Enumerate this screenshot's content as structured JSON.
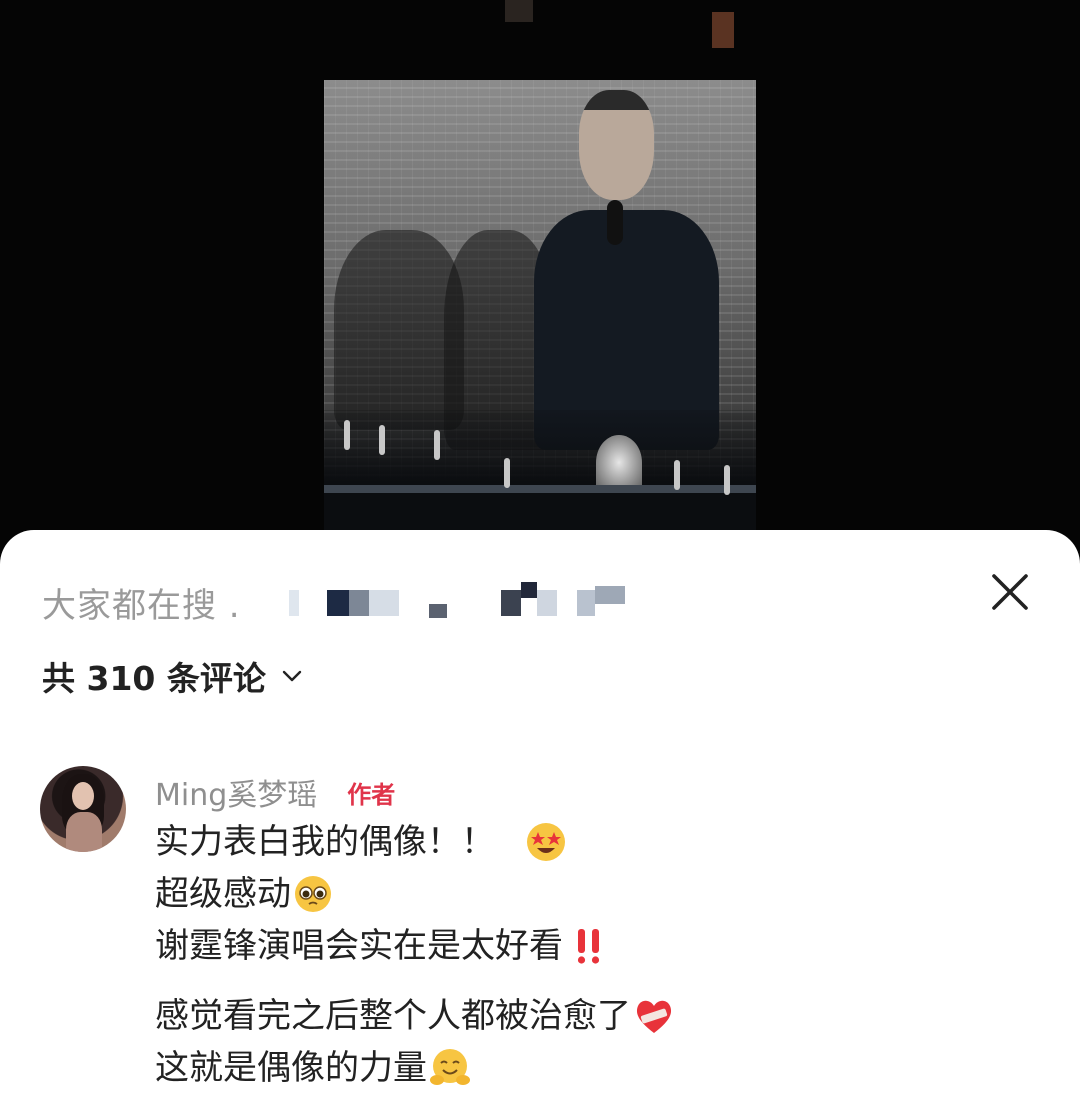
{
  "search": {
    "prefix": "大家都在搜 ."
  },
  "comments_header": {
    "count_label": "共 310 条评论"
  },
  "comment": {
    "author": "Ming奚梦瑶",
    "badge": "作者",
    "lines": [
      "实力表白我的偶像！！",
      "超级感动",
      "谢霆锋演唱会实在是太好看",
      "感觉看完之后整个人都被治愈了",
      "这就是偶像的力量"
    ],
    "emojis": [
      "star-struck-icon",
      "pleading-face-icon",
      "double-exclamation-icon",
      "mending-heart-icon",
      "hugging-face-icon"
    ]
  },
  "colors": {
    "badge": "#e0344a",
    "muted_text": "#9a9a9a",
    "body_text": "#222222",
    "sheet_bg": "#ffffff"
  }
}
